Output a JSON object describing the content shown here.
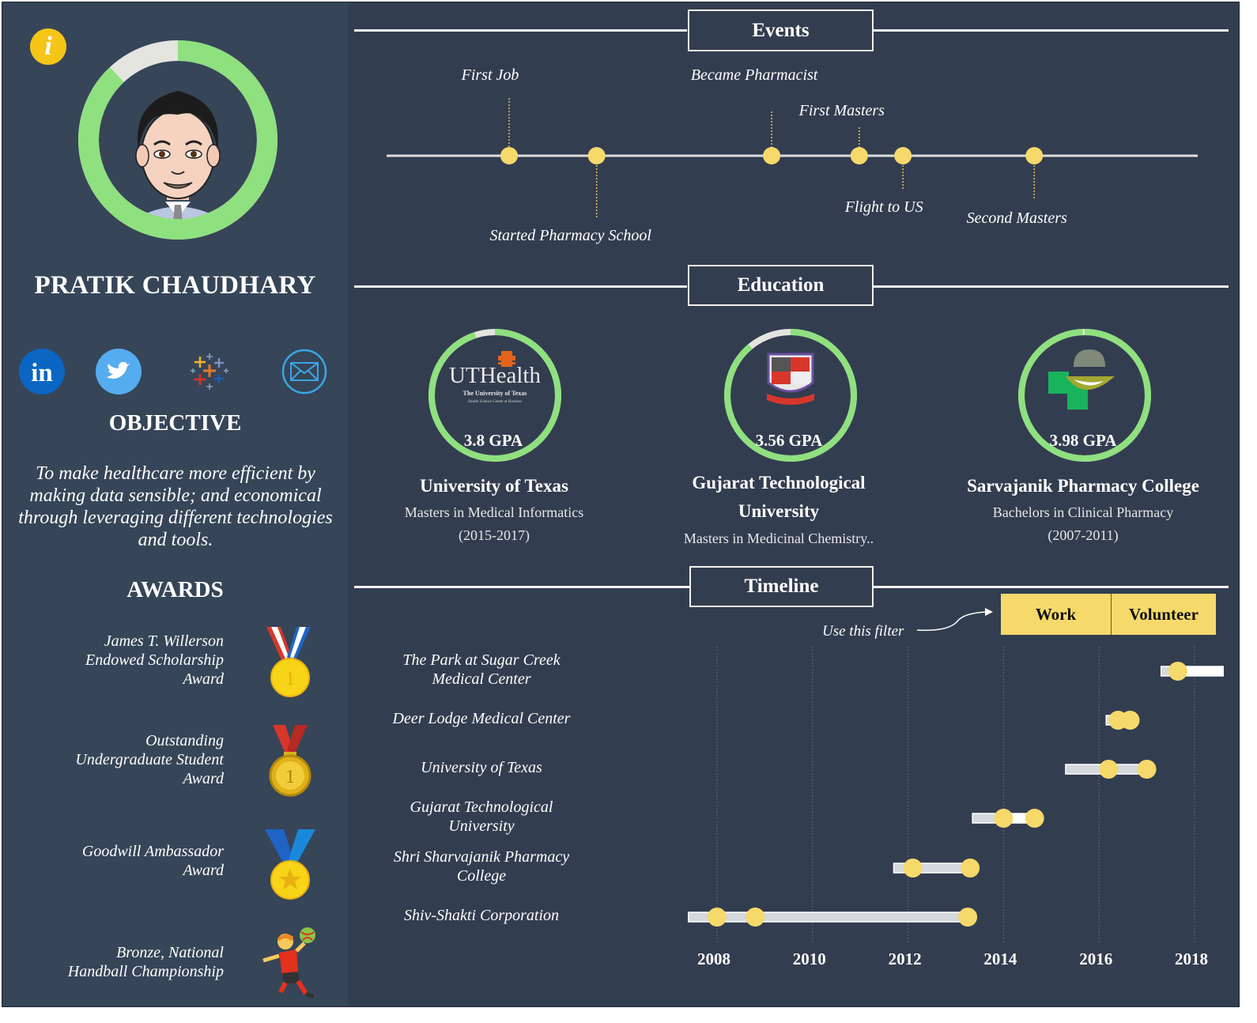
{
  "profile": {
    "name": "PRATIK CHAUDHARY",
    "info_icon": "info-icon",
    "profile_completeness": 0.88,
    "colors": {
      "ring_fill": "#8fe07e",
      "ring_track": "#e4e4e0",
      "accent_yellow": "#f6d96b",
      "info_yellow": "#f5c518"
    }
  },
  "socials": [
    {
      "name": "LinkedIn",
      "icon": "linkedin-icon",
      "color": "#0a66c2"
    },
    {
      "name": "Twitter",
      "icon": "twitter-icon",
      "color": "#55acee"
    },
    {
      "name": "Tableau",
      "icon": "tableau-icon",
      "color": "#e97627"
    },
    {
      "name": "Email",
      "icon": "email-icon",
      "color": "#3aa6e6"
    }
  ],
  "objective": {
    "heading": "OBJECTIVE",
    "lines": [
      "To make healthcare more efficient  by",
      "making data sensible;  and economical",
      "through leveraging different technologies",
      "and tools."
    ]
  },
  "awards": {
    "heading": "AWARDS",
    "items": [
      {
        "lines": [
          "James T. Willerson",
          "Endowed Scholarship",
          "Award"
        ],
        "icon": "sports-medal-icon"
      },
      {
        "lines": [
          "Outstanding",
          "Undergraduate Student",
          "Award"
        ],
        "icon": "gold-medal-icon"
      },
      {
        "lines": [
          "Goodwill Ambassador",
          "Award"
        ],
        "icon": "star-medal-icon"
      },
      {
        "lines": [
          "Bronze, National",
          "Handball Championship"
        ],
        "icon": "handball-player-icon"
      }
    ]
  },
  "events": {
    "title": "Events",
    "items": [
      {
        "label": "First Job",
        "year": 2008.0,
        "side": "above"
      },
      {
        "label": "Started Pharmacy School",
        "year": 2009.0,
        "side": "below"
      },
      {
        "label": "Became Pharmacist",
        "year": 2011.0,
        "side": "above"
      },
      {
        "label": "First Masters",
        "year": 2012.0,
        "side": "above"
      },
      {
        "label": "Flight to US",
        "year": 2012.5,
        "side": "below"
      },
      {
        "label": "Second Masters",
        "year": 2014.0,
        "side": "below"
      }
    ]
  },
  "education": {
    "title": "Education",
    "items": [
      {
        "school": "University of Texas",
        "degree": "Masters in Medical Informatics",
        "years": "(2015-2017)",
        "gpa": 3.8,
        "gpa_label": "3.8 GPA",
        "logo": "uthealth-logo-icon",
        "logo_text": "UTHealth",
        "logo_sub": "The University of Texas",
        "logo_sub2": "Health Science Center at Houston"
      },
      {
        "school": "Gujarat Technological University",
        "degree": "Masters in Medicinal Chemistry..",
        "years": "",
        "gpa": 3.56,
        "gpa_label": "3.56 GPA",
        "logo": "gtu-crest-icon"
      },
      {
        "school": "Sarvajanik Pharmacy College",
        "degree": "Bachelors in Clinical Pharmacy",
        "years": "(2007-2011)",
        "gpa": 3.98,
        "gpa_label": "3.98 GPA",
        "logo": "pharmacy-college-logo-icon"
      }
    ],
    "gpa_scale": 4.0
  },
  "timeline": {
    "title": "Timeline",
    "filter_hint": "Use this filter",
    "filters": [
      {
        "label": "Work"
      },
      {
        "label": "Volunteer"
      }
    ]
  },
  "chart_data": {
    "type": "gantt",
    "title": "Timeline",
    "x_ticks": [
      "2008",
      "2010",
      "2012",
      "2014",
      "2016",
      "2018"
    ],
    "xlim": [
      2007.4,
      2018.6
    ],
    "grid": true,
    "rows": [
      {
        "label": "The Park at Sugar Creek Medical Center",
        "label_lines": [
          "The Park at Sugar Creek",
          "Medical Center"
        ],
        "start": 2017.3,
        "end": 2018.6,
        "points": [
          2017.65
        ],
        "ongoing": true
      },
      {
        "label": "Deer Lodge Medical Center",
        "label_lines": [
          "Deer Lodge Medical Center"
        ],
        "start": 2016.15,
        "end": 2016.65,
        "points": [
          2016.4,
          2016.65
        ]
      },
      {
        "label": "University of Texas",
        "label_lines": [
          "University of Texas"
        ],
        "start": 2015.3,
        "end": 2017.0,
        "points": [
          2016.2,
          2017.0
        ]
      },
      {
        "label": "Gujarat Technological University",
        "label_lines": [
          "Gujarat Technological",
          "University"
        ],
        "start": 2013.35,
        "end": 2014.65,
        "points": [
          2014.0,
          2014.65
        ]
      },
      {
        "label": "Shri Sharvajanik Pharmacy College",
        "label_lines": [
          "Shri Sharvajanik Pharmacy",
          "College"
        ],
        "start": 2011.7,
        "end": 2013.3,
        "points": [
          2012.1,
          2013.3
        ]
      },
      {
        "label": "Shiv-Shakti Corporation",
        "label_lines": [
          "Shiv-Shakti Corporation"
        ],
        "start": 2007.4,
        "end": 2013.25,
        "points": [
          2008.0,
          2008.8,
          2013.25
        ]
      }
    ]
  }
}
